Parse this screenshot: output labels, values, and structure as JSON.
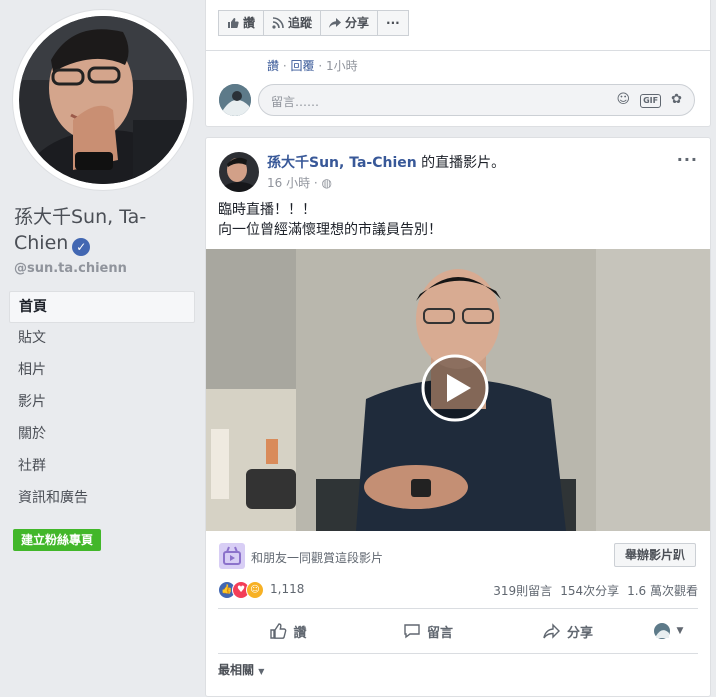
{
  "sidebar": {
    "page_name": "孫大千Sun, Ta-Chien",
    "handle": "@sun.ta.chienn",
    "nav": [
      "首頁",
      "貼文",
      "相片",
      "影片",
      "關於",
      "社群",
      "資訊和廣告"
    ],
    "create_button": "建立粉絲專頁"
  },
  "top_card": {
    "actions": {
      "like": "讚",
      "follow": "追蹤",
      "share": "分享",
      "more": "···"
    },
    "reply_meta": {
      "like": "讚",
      "reply": "回覆",
      "time": "1小時"
    },
    "comment_placeholder": "留言……"
  },
  "post": {
    "author": "孫大千Sun, Ta-Chien",
    "action_suffix": "的直播影片。",
    "time": "16 小時 ·",
    "text_line1": "臨時直播！！！",
    "text_line2": "向一位曾經滿懷理想的市議員告別！",
    "watch_party_text": "和朋友一同觀賞這段影片",
    "watch_party_button": "舉辦影片趴",
    "reaction_count": "1,118",
    "comments": "319則留言",
    "shares": "154次分享",
    "views": "1.6 萬次觀看",
    "actions": {
      "like": "讚",
      "comment": "留言",
      "share": "分享"
    },
    "sort_label": "最相關"
  },
  "colors": {
    "accent": "#4267b2",
    "link": "#385898",
    "green": "#42b72a",
    "bg": "#e9ebee"
  }
}
